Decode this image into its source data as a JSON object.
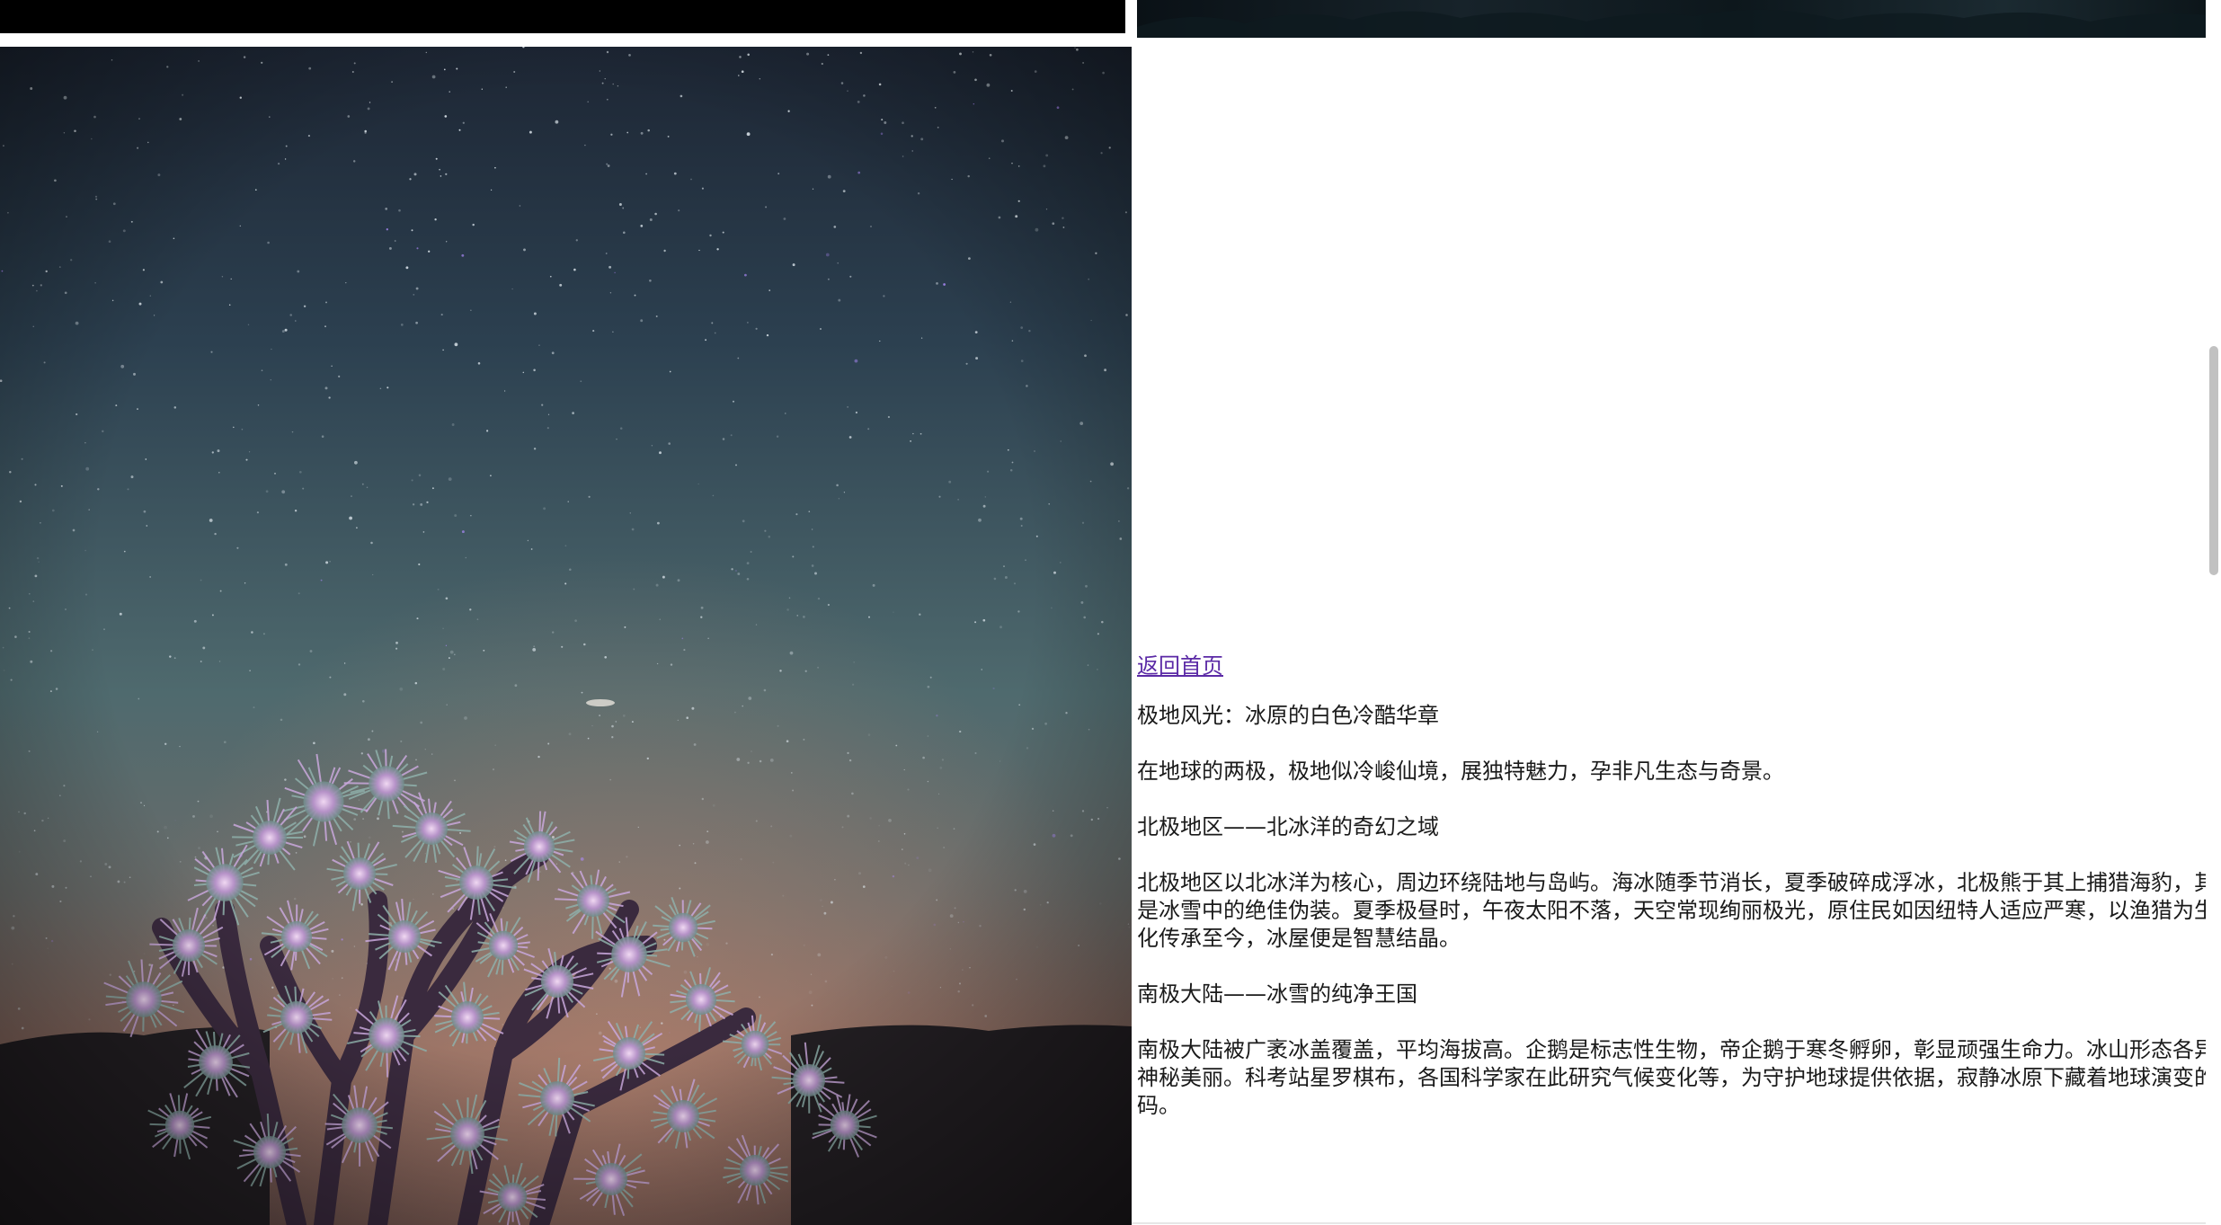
{
  "nav": {
    "back_link": "返回首页"
  },
  "article": {
    "title": "极地风光：冰原的白色冷酷华章",
    "intro": "在地球的两极，极地似冷峻仙境，展独特魅力，孕非凡生态与奇景。",
    "sections": [
      {
        "heading": "北极地区——北冰洋的奇幻之域",
        "body": "北极地区以北冰洋为核心，周边环绕陆地与岛屿。海冰随季节消长，夏季破碎成浮冰，北极熊于其上捕猎海豹，其白色皮毛是冰雪中的绝佳伪装。夏季极昼时，午夜太阳不落，天空常现绚丽极光，原住民如因纽特人适应严寒，以渔猎为生，独特文化传承至今，冰屋便是智慧结晶。"
      },
      {
        "heading": "南极大陆——冰雪的纯净王国",
        "body": "南极大陆被广袤冰盖覆盖，平均海拔高。企鹅是标志性生物，帝企鹅于寒冬孵卵，彰显顽强生命力。冰山形态各异，冰洞穴神秘美丽。科考站星罗棋布，各国科学家在此研究气候变化等，为守护地球提供依据，寂静冰原下藏着地球演变的关键密码。"
      }
    ]
  },
  "image": {
    "subject": "night-sky-joshua-tree-photo"
  },
  "colors": {
    "link": "#5b2aa6",
    "text": "#1a1a1a",
    "scrollbar_thumb": "#c1c1c1"
  }
}
